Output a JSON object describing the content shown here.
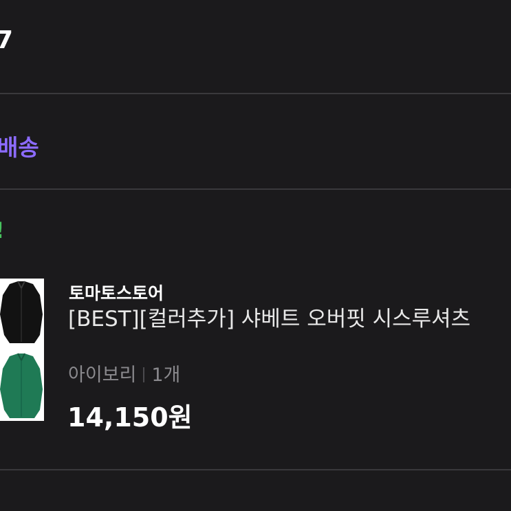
{
  "header": {
    "partial_char": "7"
  },
  "delivery": {
    "label": "배송"
  },
  "status": {
    "mark": "!"
  },
  "order_item": {
    "store_name": "토마토스토어",
    "product_name": "[BEST][컬러추가] 샤베트 오버핏 시스루셔츠",
    "option": "아이보리",
    "quantity": "1개",
    "price": "14,150원",
    "thumbnail_colors": [
      "#121212",
      "#1f7a55"
    ]
  }
}
